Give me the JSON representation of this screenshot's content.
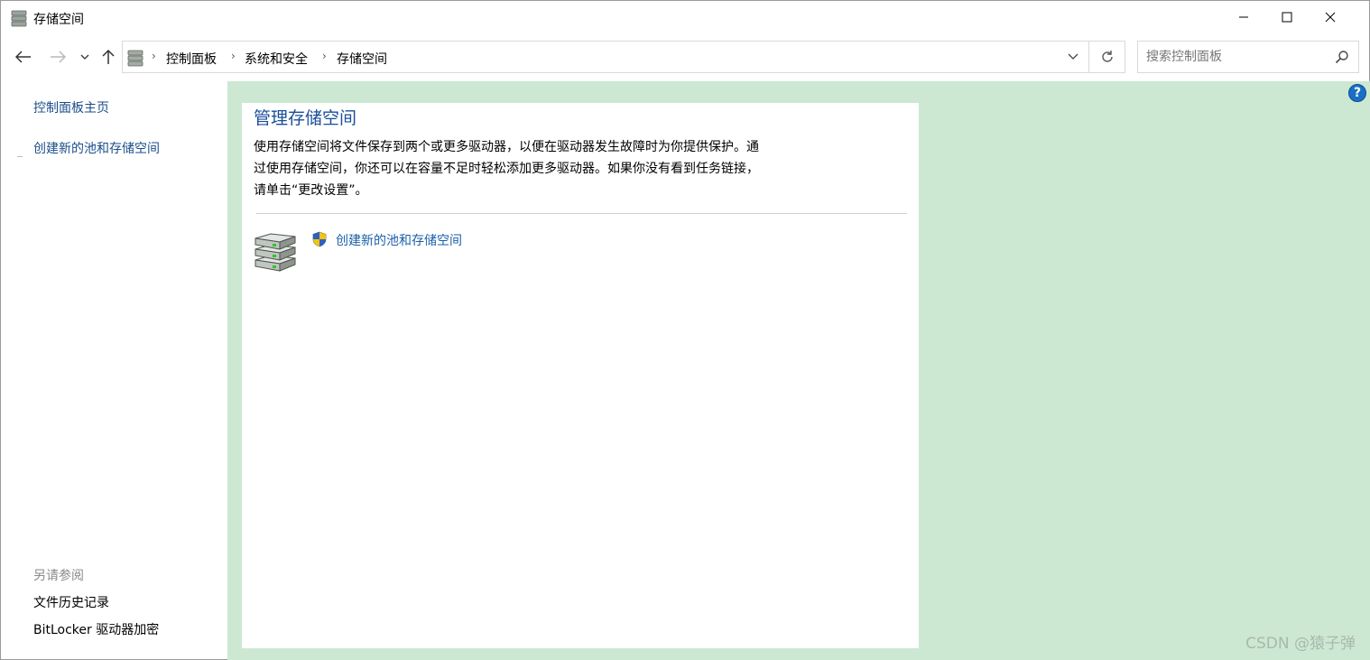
{
  "window": {
    "title": "存储空间",
    "icon": "storage-spaces-icon",
    "controls": {
      "minimize": "minimize-icon",
      "maximize": "maximize-icon",
      "close": "close-icon"
    }
  },
  "nav": {
    "back": "back-arrow-icon",
    "forward": "forward-arrow-icon",
    "recent": "chevron-down-icon",
    "up": "up-arrow-icon"
  },
  "address": {
    "breadcrumbs": [
      "控制面板",
      "系统和安全",
      "存储空间"
    ]
  },
  "search": {
    "placeholder": "搜索控制面板"
  },
  "sidebar": {
    "links": [
      "控制面板主页",
      "创建新的池和存储空间"
    ],
    "see_also_heading": "另请参阅",
    "see_also": [
      "文件历史记录",
      "BitLocker 驱动器加密"
    ]
  },
  "main": {
    "title": "管理存储空间",
    "description": "使用存储空间将文件保存到两个或更多驱动器，以便在驱动器发生故障时为你提供保护。通过使用存储空间，你还可以在容量不足时轻松添加更多驱动器。如果你没有看到任务链接，请单击“更改设置”。",
    "description_lines": [
      "使用存储空间将文件保存到两个或更多驱动器，以便在驱动器发生故障时为你提供保护。通",
      "过使用存储空间，你还可以在容量不足时轻松添加更多驱动器。如果你没有看到任务链接，",
      "请单击“更改设置”。"
    ],
    "task_link": "创建新的池和存储空间",
    "help_label": "?"
  },
  "watermark": "CSDN @猿子弹",
  "colors": {
    "content_bg": "#cde8d2",
    "link": "#1a5fa8",
    "title": "#1a4e9a"
  }
}
